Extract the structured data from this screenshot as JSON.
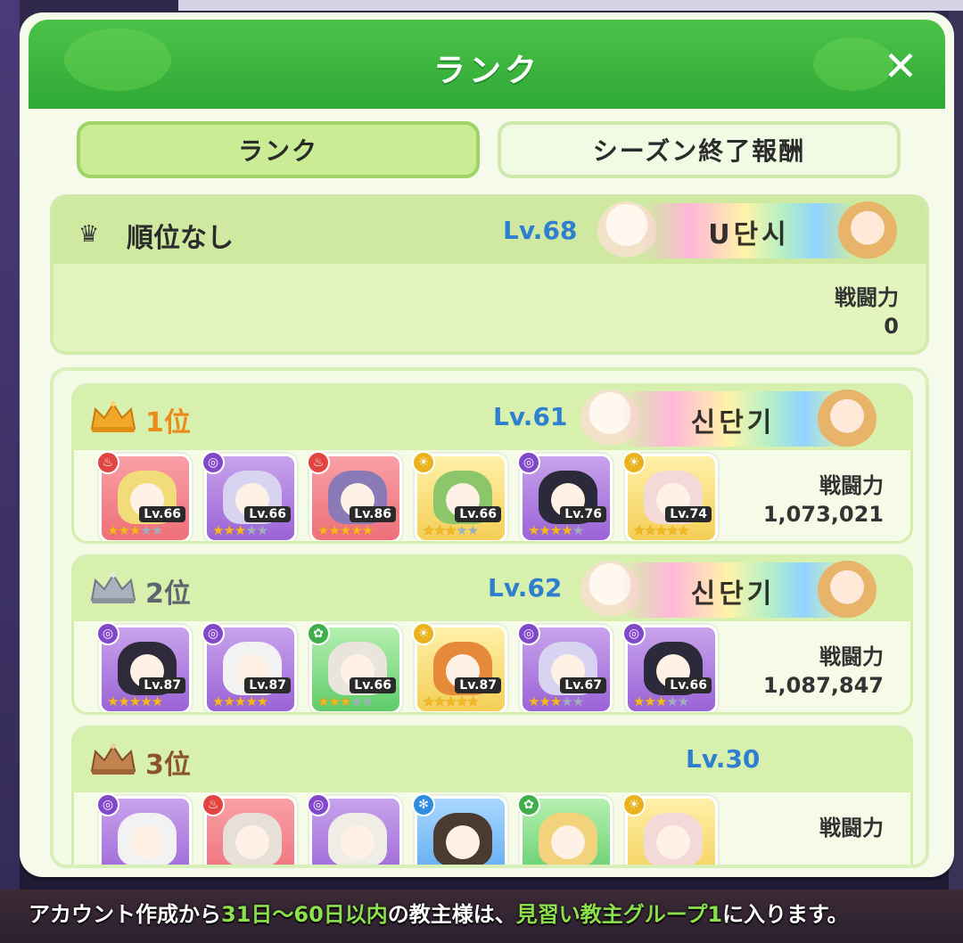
{
  "header": {
    "title": "ランク",
    "close_icon": "close-icon"
  },
  "tabs": [
    {
      "label": "ランク",
      "active": true
    },
    {
      "label": "シーズン終了報酬",
      "active": false
    }
  ],
  "my_rank": {
    "rank_text": "順位なし",
    "level": "Lv.68",
    "player_name": "U단시",
    "power_label": "戦闘力",
    "power_value": "0"
  },
  "ranking": [
    {
      "rank": "1位",
      "crown_color": "#f0a72a",
      "rank_color": "#e98c1a",
      "level": "Lv.61",
      "player_name": "신단기",
      "power_label": "戦闘力",
      "power_value": "1,073,021",
      "units": [
        {
          "element": "fire",
          "level": "Lv.66",
          "stars": 3,
          "hair": "#f2dc7a"
        },
        {
          "element": "dark",
          "level": "Lv.66",
          "stars": 3,
          "hair": "#d7d3f0"
        },
        {
          "element": "fire",
          "level": "Lv.86",
          "stars": 5,
          "hair": "#8b7ab8"
        },
        {
          "element": "light",
          "level": "Lv.66",
          "stars": 3,
          "hair": "#8cc66b"
        },
        {
          "element": "dark",
          "level": "Lv.76",
          "stars": 4,
          "hair": "#2a2a3a"
        },
        {
          "element": "light",
          "level": "Lv.74",
          "stars": 5,
          "hair": "#f4d9d9"
        }
      ]
    },
    {
      "rank": "2位",
      "crown_color": "#9aa3ad",
      "rank_color": "#5d6570",
      "level": "Lv.62",
      "player_name": "신단기",
      "power_label": "戦闘力",
      "power_value": "1,087,847",
      "units": [
        {
          "element": "dark",
          "level": "Lv.87",
          "stars": 5,
          "hair": "#2e2a3a"
        },
        {
          "element": "dark",
          "level": "Lv.87",
          "stars": 5,
          "hair": "#f2f2f2"
        },
        {
          "element": "wind",
          "level": "Lv.66",
          "stars": 3,
          "hair": "#e9e4dc"
        },
        {
          "element": "light",
          "level": "Lv.87",
          "stars": 5,
          "hair": "#e68a3a"
        },
        {
          "element": "dark",
          "level": "Lv.67",
          "stars": 3,
          "hair": "#d7d3f0"
        },
        {
          "element": "dark",
          "level": "Lv.66",
          "stars": 3,
          "hair": "#2a2a3a"
        }
      ]
    },
    {
      "rank": "3位",
      "crown_color": "#b77a45",
      "rank_color": "#8a5430",
      "level": "Lv.30",
      "player_name": "",
      "power_label": "戦闘力",
      "power_value": "",
      "units": [
        {
          "element": "dark",
          "hair": "#f2f2f2"
        },
        {
          "element": "fire",
          "hair": "#e6e0d8"
        },
        {
          "element": "dark",
          "hair": "#f0ece6"
        },
        {
          "element": "water",
          "hair": "#4a3a30"
        },
        {
          "element": "wind",
          "hair": "#f2d27a"
        },
        {
          "element": "light",
          "hair": "#f4d9d9"
        }
      ]
    }
  ],
  "footer": {
    "part1": "アカウント作成から",
    "highlight1": "31日～60日以内",
    "part2": "の教主様は、",
    "highlight2": "見習い教主グループ1",
    "part3": "に入ります。"
  }
}
